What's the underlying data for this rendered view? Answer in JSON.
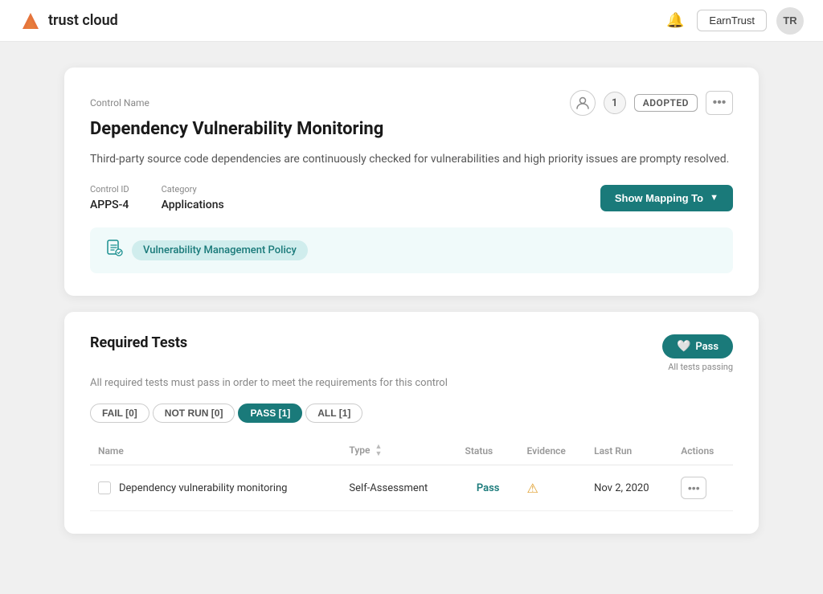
{
  "header": {
    "logo_text": "trust cloud",
    "earn_trust_label": "EarnTrust",
    "avatar_initials": "TR"
  },
  "control_card": {
    "control_name_label": "Control Name",
    "title": "Dependency Vulnerability Monitoring",
    "description": "Third-party source code dependencies are continuously checked for vulnerabilities and high priority issues are prompty resolved.",
    "control_id_label": "Control ID",
    "control_id_value": "APPS-4",
    "category_label": "Category",
    "category_value": "Applications",
    "adopted_badge": "ADOPTED",
    "badge_number": "1",
    "show_mapping_label": "Show Mapping To",
    "policy_tag": "Vulnerability Management Policy"
  },
  "required_tests": {
    "title": "Required Tests",
    "subtitle": "All required tests must pass in order to meet the requirements for this control",
    "pass_label": "Pass",
    "all_tests_passing": "All tests passing",
    "filters": [
      {
        "label": "FAIL [0]",
        "active": false
      },
      {
        "label": "NOT RUN [0]",
        "active": false
      },
      {
        "label": "PASS [1]",
        "active": true
      },
      {
        "label": "ALL [1]",
        "active": false
      }
    ],
    "table": {
      "columns": [
        "Name",
        "Type",
        "Status",
        "Evidence",
        "Last Run",
        "Actions"
      ],
      "rows": [
        {
          "name": "Dependency vulnerability monitoring",
          "type": "Self-Assessment",
          "status": "Pass",
          "evidence_icon": "warning",
          "last_run": "Nov 2, 2020"
        }
      ]
    }
  }
}
